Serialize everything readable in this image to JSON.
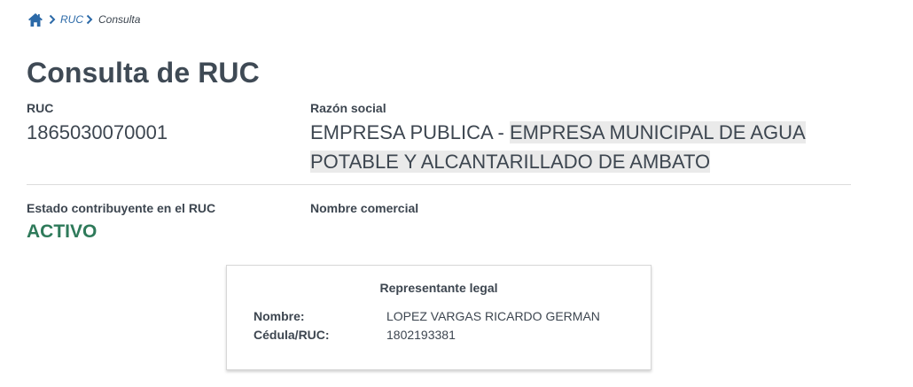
{
  "breadcrumb": {
    "home_icon": "home-icon",
    "items": [
      "RUC",
      "Consulta"
    ]
  },
  "page": {
    "title": "Consulta de RUC"
  },
  "ruc": {
    "label": "RUC",
    "value": "1865030070001"
  },
  "razon_social": {
    "label": "Razón social",
    "prefix": "EMPRESA PUBLICA - ",
    "line1": "EMPRESA MUNICIPAL DE AGUA",
    "line2": "POTABLE Y ALCANTARILLADO DE AMBATO"
  },
  "estado": {
    "label": "Estado contribuyente en el RUC",
    "value": "ACTIVO",
    "color": "#2e7a5a"
  },
  "nombre_comercial": {
    "label": "Nombre comercial",
    "value": ""
  },
  "representante": {
    "title": "Representante legal",
    "nombre_label": "Nombre:",
    "nombre_value": "LOPEZ VARGAS RICARDO GERMAN",
    "cedula_label": "Cédula/RUC:",
    "cedula_value": "1802193381"
  },
  "colors": {
    "link": "#2c6aa8",
    "text": "#3d4650",
    "highlight": "#eaeaea"
  }
}
